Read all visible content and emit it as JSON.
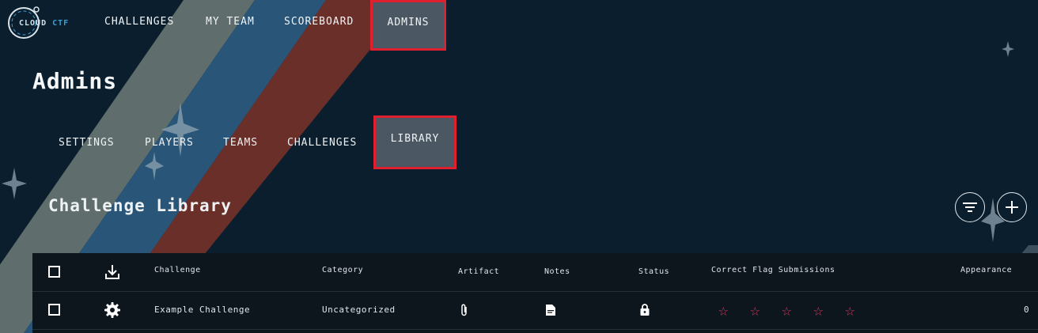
{
  "brand": {
    "name_left": "CLOUD",
    "name_right": "CTF"
  },
  "nav": {
    "challenges": "CHALLENGES",
    "my_team": "MY TEAM",
    "scoreboard": "SCOREBOARD",
    "admins": "ADMINS"
  },
  "page": {
    "title": "Admins"
  },
  "subnav": {
    "settings": "SETTINGS",
    "players": "PLAYERS",
    "teams": "TEAMS",
    "challenges": "CHALLENGES",
    "library": "LIBRARY"
  },
  "library": {
    "title": "Challenge Library",
    "columns": {
      "challenge": "Challenge",
      "category": "Category",
      "artifact": "Artifact",
      "notes": "Notes",
      "status": "Status",
      "correct_flag_submissions": "Correct Flag Submissions",
      "appearance": "Appearance"
    },
    "rows": [
      {
        "challenge": "Example Challenge",
        "category": "Uncategorized",
        "rating_stars": 5,
        "rating_filled": 0,
        "appearance": "0"
      }
    ]
  },
  "colors": {
    "background": "#0b1e2d",
    "active_highlight": "#4b5863",
    "active_border": "#e0202e",
    "star": "#e8365f",
    "stripe_gray": "#7c8a82",
    "stripe_blue": "#2f5f86",
    "stripe_red": "#7a3328"
  },
  "icons": {
    "filter": "filter-icon",
    "add": "plus-icon",
    "download": "download-icon",
    "settings": "gear-icon",
    "artifact": "paperclip-icon",
    "notes": "note-icon",
    "status": "lock-icon",
    "rating": "star-outline-icon"
  }
}
